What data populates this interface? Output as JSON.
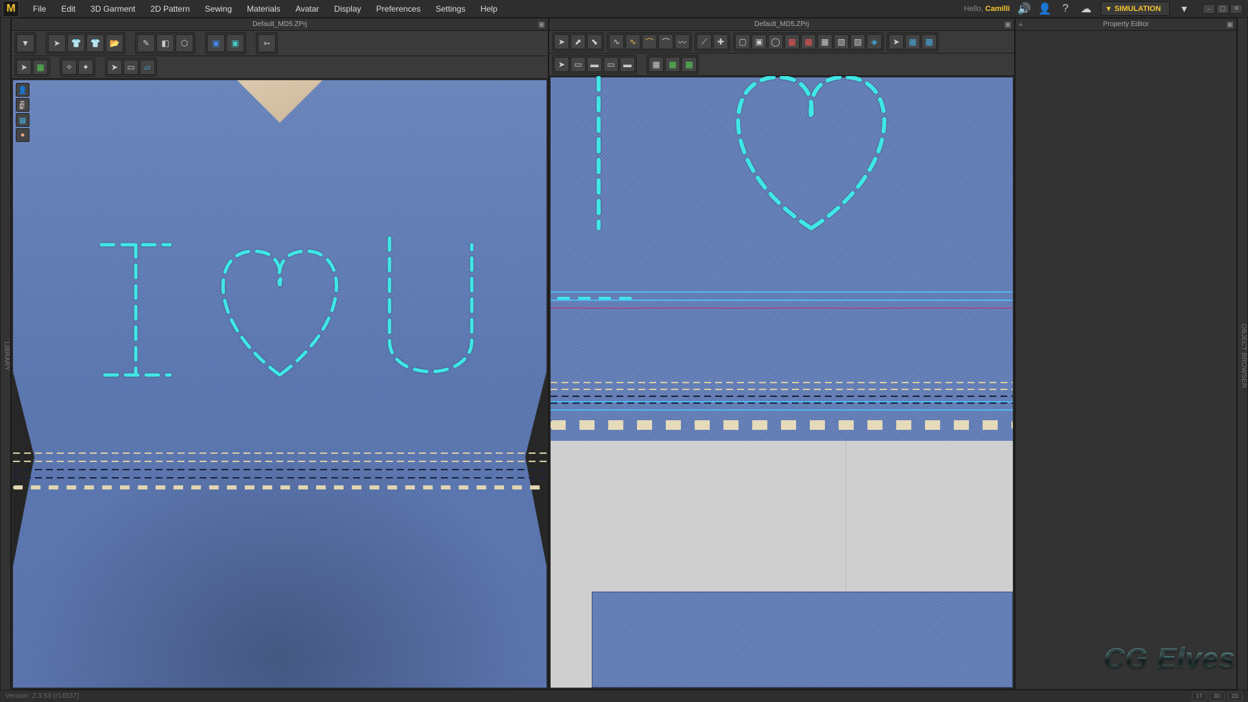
{
  "app": {
    "logo_letter": "M"
  },
  "menubar": {
    "items": [
      "File",
      "Edit",
      "3D Garment",
      "2D Pattern",
      "Sewing",
      "Materials",
      "Avatar",
      "Display",
      "Preferences",
      "Settings",
      "Help"
    ],
    "hello_prefix": "Hello, ",
    "username": "Camilli",
    "sim_button": "SIMULATION"
  },
  "panels": {
    "left_title": "Default_MD5.ZPrj",
    "right_title": "Default_MD5.ZPrj",
    "prop_title": "Property Editor"
  },
  "toolbar3d_row1": {
    "save": "save-icon",
    "arrow": "arrow-select-icon",
    "shirt_g": "garment-green-icon",
    "shirt_p": "garment-pink-icon",
    "folder": "folder-open-icon",
    "pen": "pen-icon",
    "eraser": "eraser-icon",
    "avatar": "avatar-tool-icon",
    "box_b": "box-blue-icon",
    "box_c": "box-cyan-icon",
    "tack": "pin-icon"
  },
  "toolbar3d_row2": {
    "sel": "select-icon",
    "grid": "grid-green-icon",
    "lamp": "light-icon",
    "lamp2": "light2-icon",
    "cur": "cursor-icon",
    "sheet": "sheet-icon",
    "plane": "plane-icon"
  },
  "toolbar2d_row1": {
    "a1": "arrow-icon",
    "a2": "arrow2-icon",
    "a3": "arrow3-icon",
    "c1": "curve-icon",
    "c2": "curve2-icon",
    "c3": "curve3-icon",
    "c4": "curve4-icon",
    "c5": "curve5-icon",
    "p1": "point-icon",
    "p2": "point2-icon",
    "s1": "square-icon",
    "s2": "square-fill-icon",
    "s3": "circle-icon",
    "s4": "pattern1-icon",
    "s5": "pattern2-icon",
    "s6": "pattern3-icon",
    "s7": "pattern4-icon",
    "s8": "checker-icon",
    "s9": "diamond-icon",
    "r1": "arrow-r-icon",
    "r2": "tex1-icon",
    "r3": "tex2-icon"
  },
  "toolbar2d_row2": {
    "b1": "sel2-icon",
    "b2": "seam1-icon",
    "b3": "seam2-icon",
    "b4": "seam3-icon",
    "b5": "seam4-icon",
    "g1": "grid-a-icon",
    "g2": "grid-b-icon",
    "g3": "grid-c-icon"
  },
  "viewport_icons": {
    "i1": "avatar-show-icon",
    "i2": "avatar-head-icon",
    "i3": "texture-icon",
    "i4": "face-icon"
  },
  "status": {
    "version": "Version: 2.3.53   (r14537)",
    "btns": [
      "1T",
      "3D",
      "2D"
    ]
  },
  "watermark": "CG Elves"
}
